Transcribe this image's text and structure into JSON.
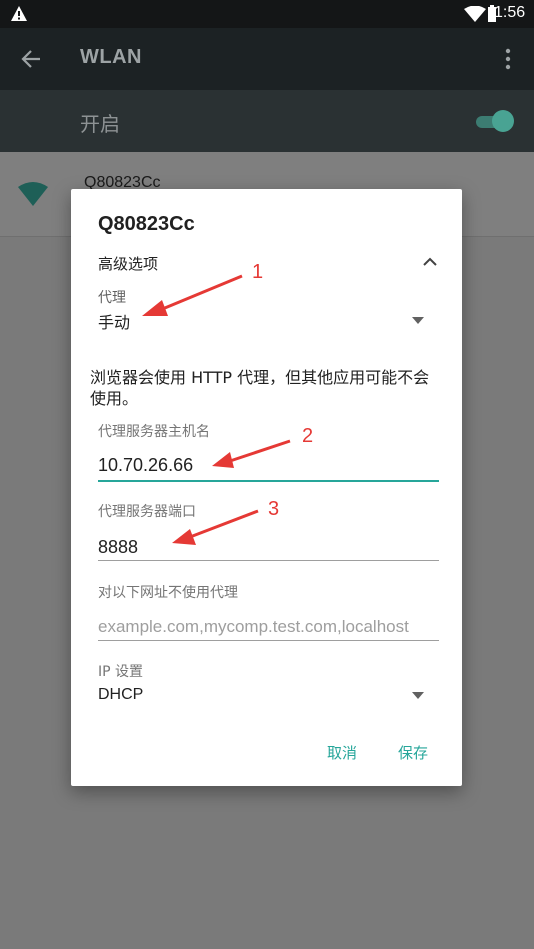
{
  "status_bar": {
    "time": "1:56"
  },
  "app_bar": {
    "title": "WLAN"
  },
  "switch_bar": {
    "label": "开启",
    "enabled": true
  },
  "network": {
    "ssid": "Q80823Cc"
  },
  "dialog": {
    "title": "Q80823Cc",
    "advanced_label": "高级选项",
    "proxy": {
      "label": "代理",
      "value": "手动"
    },
    "note": "浏览器会使用 HTTP 代理，但其他应用可能不会使用。",
    "hostname": {
      "label": "代理服务器主机名",
      "value": "10.70.26.66"
    },
    "port": {
      "label": "代理服务器端口",
      "value": "8888"
    },
    "bypass": {
      "label": "对以下网址不使用代理",
      "placeholder": "example.com,mycomp.test.com,localhost"
    },
    "ip_settings": {
      "label": "IP 设置",
      "value": "DHCP"
    },
    "cancel_label": "取消",
    "save_label": "保存"
  },
  "annotations": {
    "n1": "1",
    "n2": "2",
    "n3": "3"
  },
  "colors": {
    "accent": "#26a69a",
    "annotation": "#e53935",
    "appbar": "#1c2224"
  },
  "icons": [
    "warning-icon",
    "wifi-icon",
    "battery-icon",
    "back-arrow-icon",
    "more-vert-icon",
    "wifi-signal-icon",
    "chevron-up-icon",
    "dropdown-arrow-icon"
  ]
}
